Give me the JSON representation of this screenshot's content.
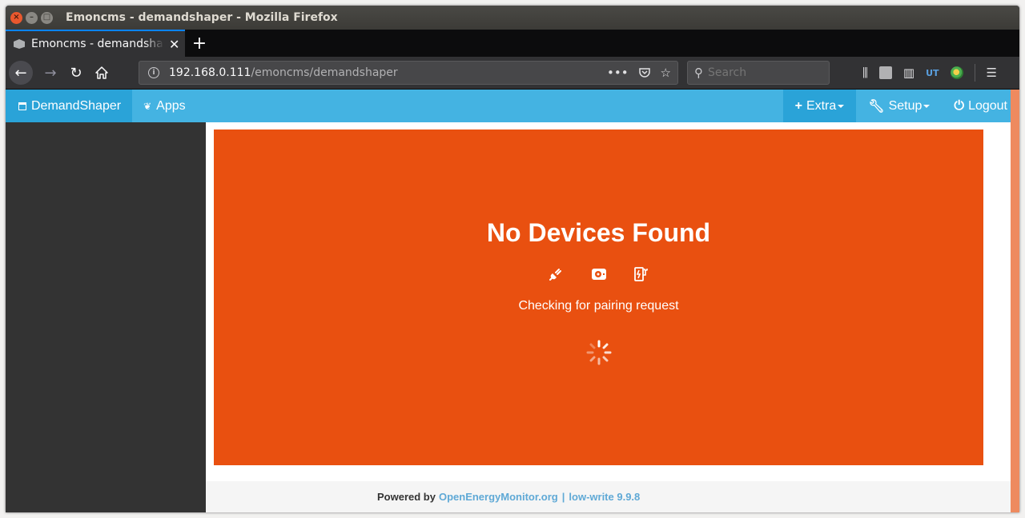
{
  "window": {
    "title": "Emoncms - demandshaper - Mozilla Firefox"
  },
  "tab": {
    "title": "Emoncms - demandshaper",
    "close_icon": "close-icon"
  },
  "navbar": {
    "url_host": "192.168.0.111",
    "url_path": "/emoncms/demandshaper",
    "search_placeholder": "Search"
  },
  "app_nav": {
    "brand_label": "DemandShaper",
    "apps_label": "Apps",
    "extra_label": "Extra",
    "setup_label": "Setup",
    "logout_label": "Logout"
  },
  "main": {
    "heading": "No Devices Found",
    "status": "Checking for pairing request",
    "device_icons": [
      "plug-icon",
      "heatpump-icon",
      "ev-charger-icon"
    ]
  },
  "footer": {
    "powered_by": "Powered by",
    "link_text": "OpenEnergyMonitor.org",
    "separator": "|",
    "version": "low-write 9.9.8"
  },
  "colors": {
    "panel": "#e95010",
    "nav": "#44b3e2",
    "nav_active": "#2aa3d8",
    "sidebar": "#333333"
  }
}
